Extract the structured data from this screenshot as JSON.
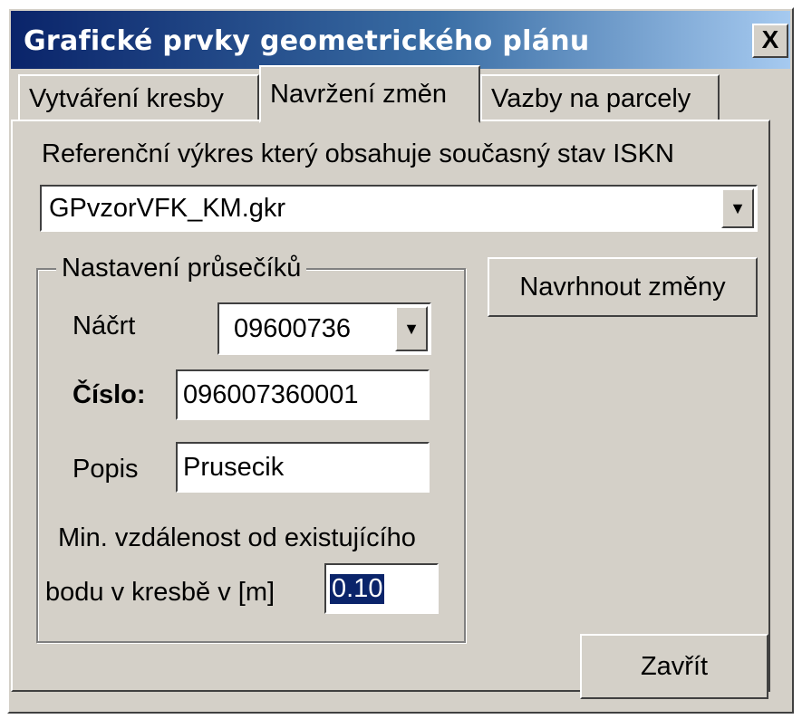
{
  "window": {
    "title": "Grafické prvky geometrického plánu",
    "close_label": "X"
  },
  "tabs": [
    {
      "label": "Vytváření kresby",
      "active": false
    },
    {
      "label": "Navržení změn",
      "active": true
    },
    {
      "label": "Vazby na parcely",
      "active": false
    }
  ],
  "reference": {
    "label": "Referenční výkres který obsahuje současný stav ISKN",
    "value": "GPvzorVFK_KM.gkr"
  },
  "intersections": {
    "group_label": "Nastavení průsečíků",
    "sketch_label": "Náčrt",
    "sketch_value": "09600736",
    "number_label": "Číslo:",
    "number_value": "096007360001",
    "description_label": "Popis",
    "description_value": "Prusecik",
    "min_distance_label_1": "Min. vzdálenost od existujícího",
    "min_distance_label_2": "bodu v kresbě v [m]",
    "min_distance_value": "0.10"
  },
  "buttons": {
    "propose": "Navrhnout změny",
    "close": "Zavřít"
  },
  "colors": {
    "title_start": "#0a246a",
    "title_end": "#a6caf0",
    "face": "#d4d0c8",
    "selection": "#0a246a"
  },
  "icons": {
    "dropdown": "triangle-down",
    "close": "x"
  }
}
